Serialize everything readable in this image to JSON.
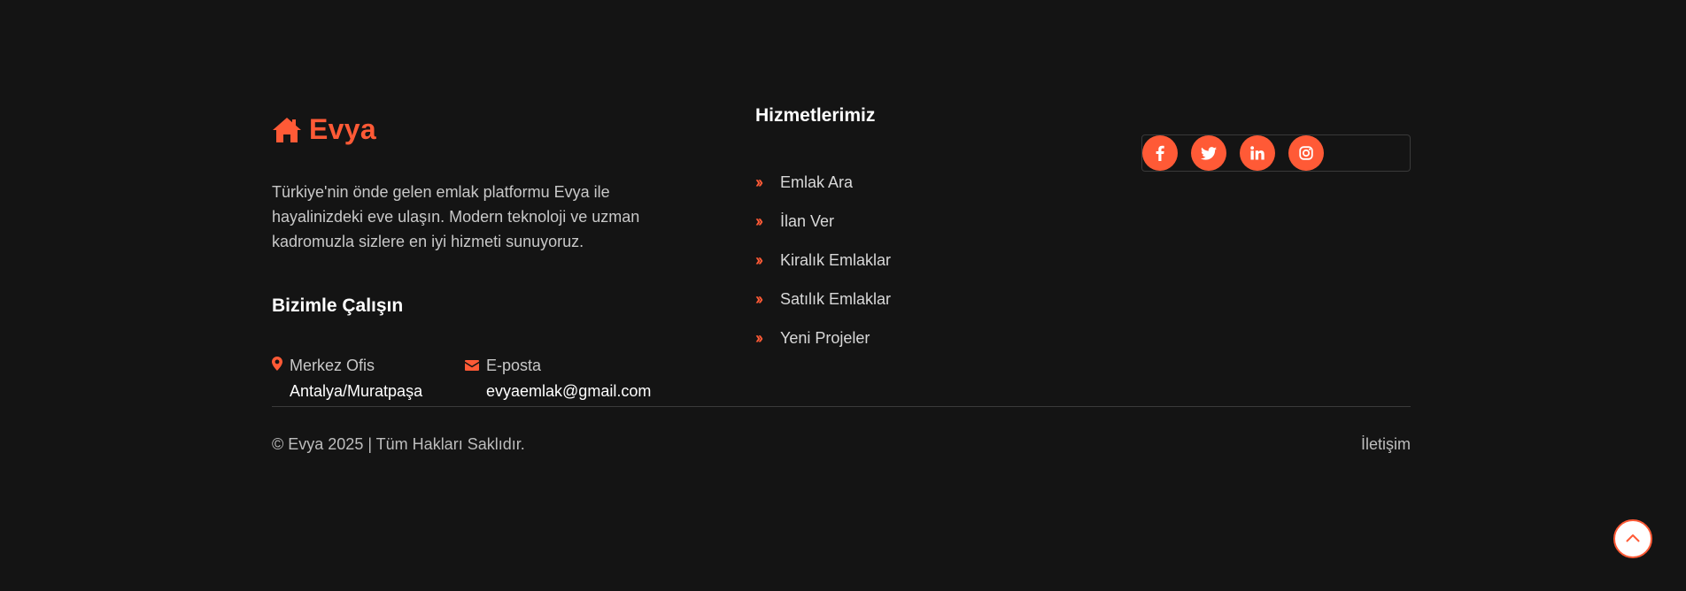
{
  "brand": {
    "name": "Evya",
    "icon": "house-icon",
    "accent_color": "#ff5a36"
  },
  "about": {
    "text": "Türkiye'nin önde gelen emlak platformu Evya ile hayalinizdeki eve ulaşın. Modern teknoloji ve uzman kadromuzla sizlere en iyi hizmeti sunuyoruz."
  },
  "work_with_us": {
    "title": "Bizimle Çalışın",
    "office": {
      "icon": "map-marker-icon",
      "label": "Merkez Ofis",
      "value": "Antalya/Muratpaşa"
    },
    "email": {
      "icon": "envelope-icon",
      "label": "E-posta",
      "value": "evyaemlak@gmail.com"
    }
  },
  "services": {
    "title": "Hizmetlerimiz",
    "items": [
      {
        "label": "Emlak Ara"
      },
      {
        "label": "İlan Ver"
      },
      {
        "label": "Kiralık Emlaklar"
      },
      {
        "label": "Satılık Emlaklar"
      },
      {
        "label": "Yeni Projeler"
      }
    ]
  },
  "social": [
    {
      "name": "facebook-icon"
    },
    {
      "name": "twitter-icon"
    },
    {
      "name": "linkedin-icon"
    },
    {
      "name": "instagram-icon"
    }
  ],
  "bottom": {
    "copyright": "© Evya 2025 | Tüm Hakları Saklıdır.",
    "contact_link": "İletişim"
  },
  "back_to_top": {
    "icon": "chevron-up-icon"
  }
}
